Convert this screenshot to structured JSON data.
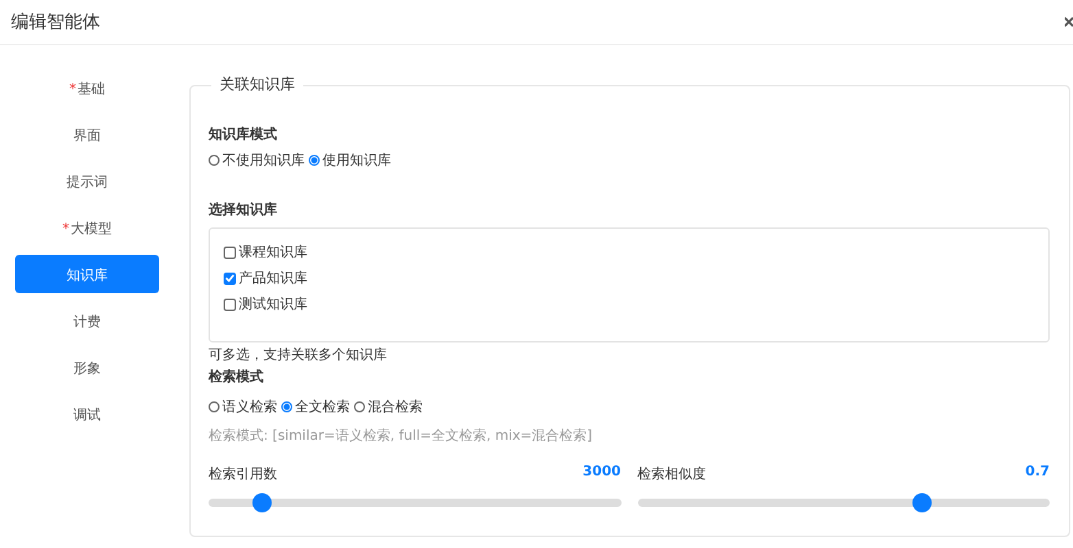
{
  "dialog": {
    "title": "编辑智能体"
  },
  "nav": [
    {
      "label": "基础",
      "required_mark": "*",
      "selected": false
    },
    {
      "label": "界面",
      "selected": false
    },
    {
      "label": "提示词",
      "selected": false
    },
    {
      "label": "大模型",
      "required_mark": "*",
      "selected": false
    },
    {
      "label": "知识库",
      "selected": true
    },
    {
      "label": "计费",
      "selected": false
    },
    {
      "label": "形象",
      "selected": false
    },
    {
      "label": "调试",
      "selected": false
    }
  ],
  "panel": {
    "legend": "关联知识库",
    "kb_mode": {
      "label": "知识库模式",
      "options": [
        {
          "label": "不使用知识库",
          "selected": false
        },
        {
          "label": "使用知识库",
          "selected": true
        }
      ]
    },
    "kb_select": {
      "label": "选择知识库",
      "items": [
        {
          "label": "课程知识库",
          "checked": false
        },
        {
          "label": "产品知识库",
          "checked": true
        },
        {
          "label": "测试知识库",
          "checked": false
        }
      ],
      "hint": "可多选，支持关联多个知识库"
    },
    "search_mode": {
      "label": "检索模式",
      "options": [
        {
          "label": "语义检索",
          "selected": false
        },
        {
          "label": "全文检索",
          "selected": true
        },
        {
          "label": "混合检索",
          "selected": false
        }
      ],
      "hint": "检索模式: [similar=语义检索, full=全文检索, mix=混合检索]"
    },
    "sliders": [
      {
        "label": "检索引用数",
        "reading": "3000",
        "level": 0.13
      },
      {
        "label": "检索相似度",
        "reading": "0.7",
        "level": 0.69
      }
    ]
  }
}
